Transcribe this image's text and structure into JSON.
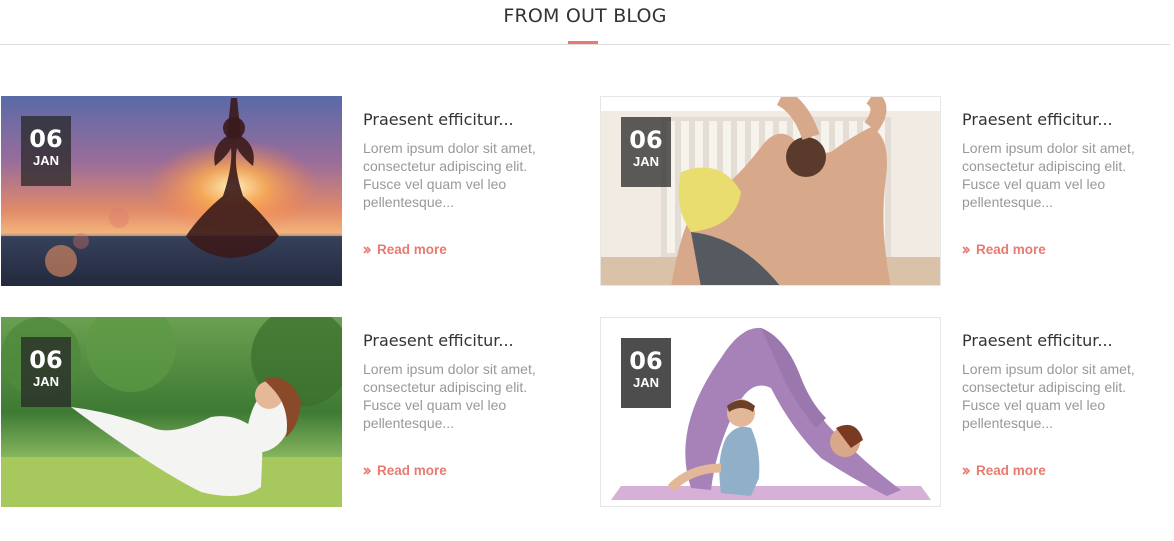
{
  "section": {
    "title": "FROM OUT BLOG"
  },
  "colors": {
    "accent": "#e87a70",
    "title": "#333333",
    "excerpt": "#999999",
    "badge": "#3a3a3a"
  },
  "posts": [
    {
      "day": "06",
      "month": "JAN",
      "title": "Praesent efficitur...",
      "excerpt": "Lorem ipsum dolor sit amet, consectetur adipiscing elit. Fusce vel quam vel leo pellentesque...",
      "read_more": "Read more",
      "image": "yoga-sunset-meditation-photo"
    },
    {
      "day": "06",
      "month": "JAN",
      "title": "Praesent efficitur...",
      "excerpt": "Lorem ipsum dolor sit amet, consectetur adipiscing elit. Fusce vel quam vel leo pellentesque...",
      "read_more": "Read more",
      "image": "yoga-backbend-stretch-photo"
    },
    {
      "day": "06",
      "month": "JAN",
      "title": "Praesent efficitur...",
      "excerpt": "Lorem ipsum dolor sit amet, consectetur adipiscing elit. Fusce vel quam vel leo pellentesque...",
      "read_more": "Read more",
      "image": "yoga-park-boat-pose-photo"
    },
    {
      "day": "06",
      "month": "JAN",
      "title": "Praesent efficitur...",
      "excerpt": "Lorem ipsum dolor sit amet, consectetur adipiscing elit. Fusce vel quam vel leo pellentesque...",
      "read_more": "Read more",
      "image": "yoga-mother-child-downward-dog-photo"
    }
  ]
}
